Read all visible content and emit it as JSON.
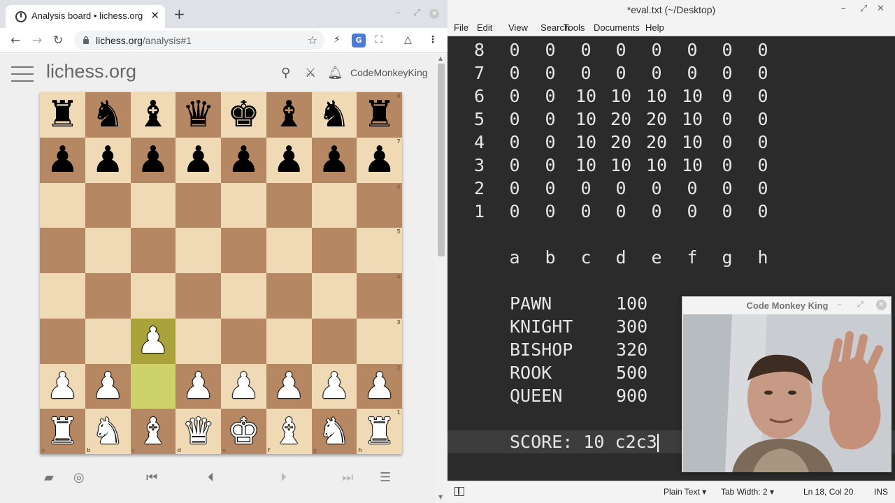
{
  "browser": {
    "tab_title": "Analysis board • lichess.org",
    "tab_close": "✕",
    "new_tab": "+",
    "url_host": "lichess.org",
    "url_path": "/analysis#1",
    "star": "☆",
    "translate": "G"
  },
  "lichess": {
    "brand": "lichess.org",
    "username": "CodeMonkeyKing",
    "board": {
      "ranks": [
        [
          "r",
          "n",
          "b",
          "q",
          "k",
          "b",
          "n",
          "r"
        ],
        [
          "p",
          "p",
          "p",
          "p",
          "p",
          "p",
          "p",
          "p"
        ],
        [
          "",
          "",
          "",
          "",
          "",
          "",
          "",
          ""
        ],
        [
          "",
          "",
          "",
          "",
          "",
          "",
          "",
          ""
        ],
        [
          "",
          "",
          "",
          "",
          "",
          "",
          "",
          ""
        ],
        [
          "",
          "",
          "P",
          "",
          "",
          "",
          "",
          ""
        ],
        [
          "P",
          "P",
          "",
          "P",
          "P",
          "P",
          "P",
          "P"
        ],
        [
          "R",
          "N",
          "B",
          "Q",
          "K",
          "B",
          "N",
          "R"
        ]
      ],
      "rank_labels": [
        "8",
        "7",
        "6",
        "5",
        "4",
        "3",
        "2",
        "1"
      ],
      "file_labels": [
        "a",
        "b",
        "c",
        "d",
        "e",
        "f",
        "g",
        "h"
      ],
      "last_move_from": "c2",
      "last_move_to": "c3"
    }
  },
  "editor": {
    "title": "*eval.txt (~/Desktop)",
    "menu": [
      "File",
      "Edit",
      "View",
      "Search",
      "Tools",
      "Documents",
      "Help"
    ],
    "grid": [
      {
        "rank": "8",
        "values": [
          "0",
          "0",
          "0",
          "0",
          "0",
          "0",
          "0",
          "0"
        ]
      },
      {
        "rank": "7",
        "values": [
          "0",
          "0",
          "0",
          "0",
          "0",
          "0",
          "0",
          "0"
        ]
      },
      {
        "rank": "6",
        "values": [
          "0",
          "0",
          "10",
          "10",
          "10",
          "10",
          "0",
          "0"
        ]
      },
      {
        "rank": "5",
        "values": [
          "0",
          "0",
          "10",
          "20",
          "20",
          "10",
          "0",
          "0"
        ]
      },
      {
        "rank": "4",
        "values": [
          "0",
          "0",
          "10",
          "20",
          "20",
          "10",
          "0",
          "0"
        ]
      },
      {
        "rank": "3",
        "values": [
          "0",
          "0",
          "10",
          "10",
          "10",
          "10",
          "0",
          "0"
        ]
      },
      {
        "rank": "2",
        "values": [
          "0",
          "0",
          "0",
          "0",
          "0",
          "0",
          "0",
          "0"
        ]
      },
      {
        "rank": "1",
        "values": [
          "0",
          "0",
          "0",
          "0",
          "0",
          "0",
          "0",
          "0"
        ]
      }
    ],
    "files": [
      "a",
      "b",
      "c",
      "d",
      "e",
      "f",
      "g",
      "h"
    ],
    "pieces": [
      {
        "name": "PAWN",
        "value": "100"
      },
      {
        "name": "KNIGHT",
        "value": "300"
      },
      {
        "name": "BISHOP",
        "value": "320"
      },
      {
        "name": "ROOK",
        "value": "500"
      },
      {
        "name": "QUEEN",
        "value": "900"
      }
    ],
    "score_line": "SCORE: 10 c2c3",
    "status": {
      "syntax": "Plain Text",
      "tab_width": "Tab Width: 2",
      "position": "Ln 18, Col 20",
      "mode": "INS"
    }
  },
  "webcam": {
    "title": "Code Monkey King"
  }
}
